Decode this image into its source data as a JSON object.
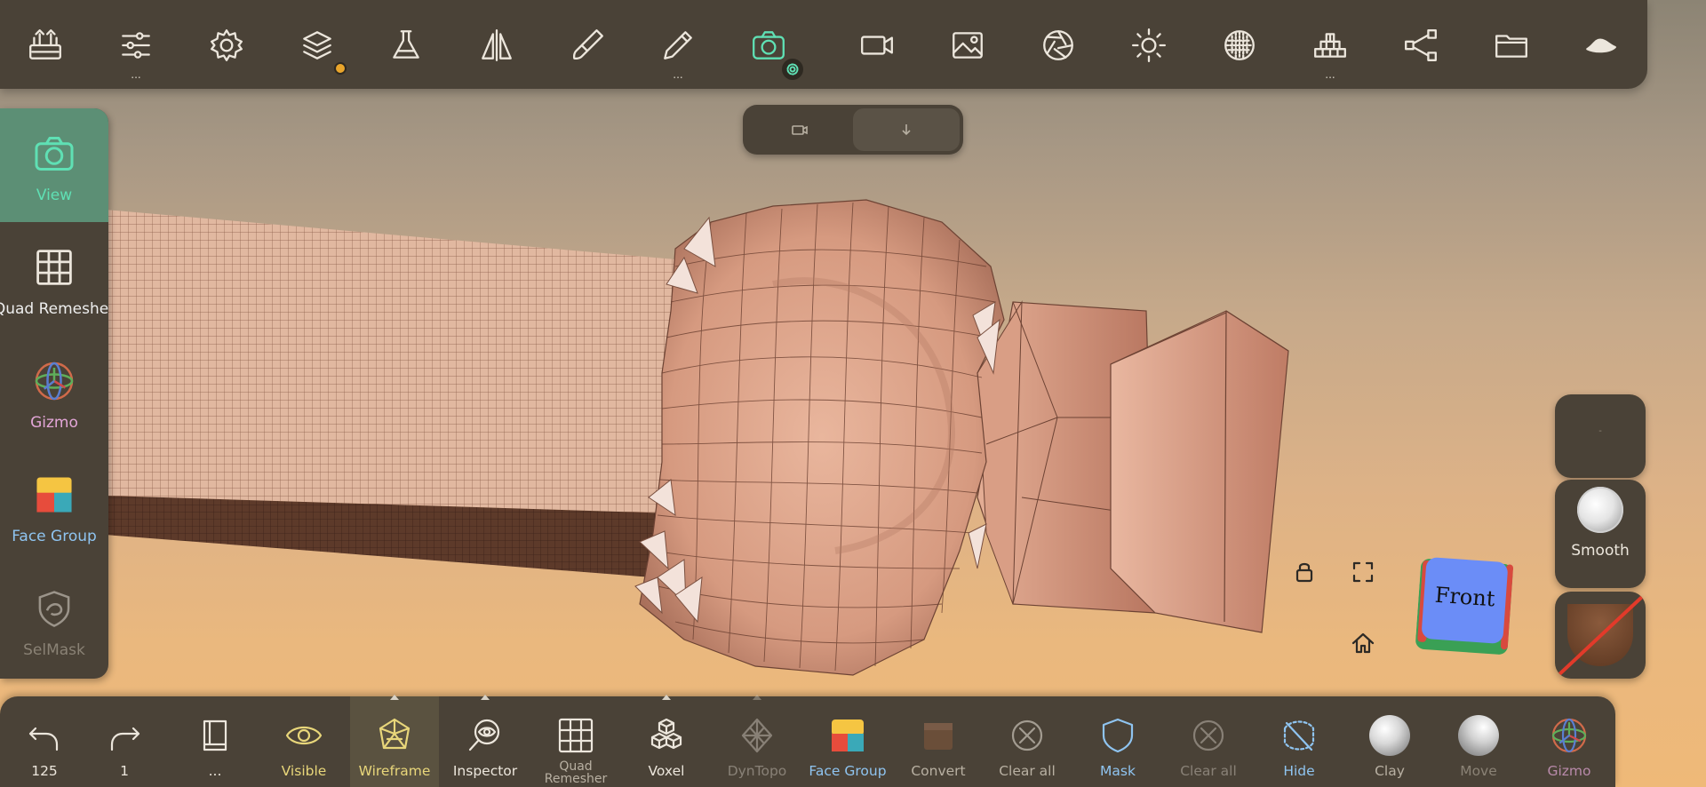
{
  "colors": {
    "panel": "#4a4237",
    "accent_teal": "#5fe0b4",
    "active_bg": "#5c8f75",
    "wireframe_yellow": "#e8d67a",
    "mask_blue": "#8fc4f0",
    "gizmo_pink": "#e3a6d8",
    "face_group_blue": "#8fc4f0",
    "skin": "#d49a80"
  },
  "top_toolbar": {
    "items": [
      {
        "icon": "toolbox-icon"
      },
      {
        "icon": "sliders-icon",
        "dots": "..."
      },
      {
        "icon": "gear-icon"
      },
      {
        "icon": "layers-icon",
        "badge": "orange-dot"
      },
      {
        "icon": "flask-icon"
      },
      {
        "icon": "symmetry-icon"
      },
      {
        "icon": "brush-icon"
      },
      {
        "icon": "pen-icon",
        "dots": "..."
      },
      {
        "icon": "camera-icon",
        "active": true
      },
      {
        "icon": "video-icon"
      },
      {
        "icon": "image-icon"
      },
      {
        "icon": "aperture-icon"
      },
      {
        "icon": "sun-icon"
      },
      {
        "icon": "matcap-icon"
      },
      {
        "icon": "bars-stack-icon",
        "dots": "..."
      },
      {
        "icon": "share-nodes-icon"
      },
      {
        "icon": "folder-icon"
      },
      {
        "icon": "hat-icon"
      }
    ]
  },
  "sub_toolbar": {
    "items": [
      {
        "icon": "video-small-icon"
      },
      {
        "icon": "arrow-down-icon",
        "selected": true
      }
    ]
  },
  "left_panel": {
    "items": [
      {
        "label": "View",
        "icon": "camera-icon",
        "active": true
      },
      {
        "label": "Quad Remesher",
        "icon": "grid-icon"
      },
      {
        "label": "Gizmo",
        "icon": "gizmo-icon"
      },
      {
        "label": "Face Group",
        "icon": "face-group-icon"
      },
      {
        "label": "SelMask",
        "icon": "selmask-icon",
        "disabled": true
      }
    ]
  },
  "viewport": {
    "cube_label": "Front",
    "controls": [
      "lock-icon",
      "fullscreen-icon",
      "home-icon"
    ]
  },
  "right_panel": {
    "top_label": "-",
    "smooth_label": "Smooth"
  },
  "bottom_toolbar": {
    "items": [
      {
        "label": "125",
        "icon": "undo-icon"
      },
      {
        "label": "1",
        "icon": "redo-icon"
      },
      {
        "label": "...",
        "icon": "book-icon"
      },
      {
        "label": "Visible",
        "icon": "eye-icon"
      },
      {
        "label": "Wireframe",
        "icon": "wireframe-icon",
        "selected": true
      },
      {
        "label": "Inspector",
        "icon": "inspector-icon"
      },
      {
        "label": "Quad Remesher",
        "icon": "grid-icon"
      },
      {
        "label": "Voxel",
        "icon": "voxel-icon"
      },
      {
        "label": "DynTopo",
        "icon": "dyntopo-icon",
        "disabled": true
      },
      {
        "label": "Face Group",
        "icon": "face-group-icon"
      },
      {
        "label": "Convert",
        "icon": "convert-icon"
      },
      {
        "label": "Clear all",
        "icon": "clear-all-icon"
      },
      {
        "label": "Mask",
        "icon": "shield-icon"
      },
      {
        "label": "Clear all",
        "icon": "clear-all-icon",
        "disabled": true
      },
      {
        "label": "Hide",
        "icon": "hide-icon"
      },
      {
        "label": "Clay",
        "icon": "clay-icon"
      },
      {
        "label": "Move",
        "icon": "move-icon"
      },
      {
        "label": "Gizmo",
        "icon": "gizmo-icon"
      }
    ]
  }
}
